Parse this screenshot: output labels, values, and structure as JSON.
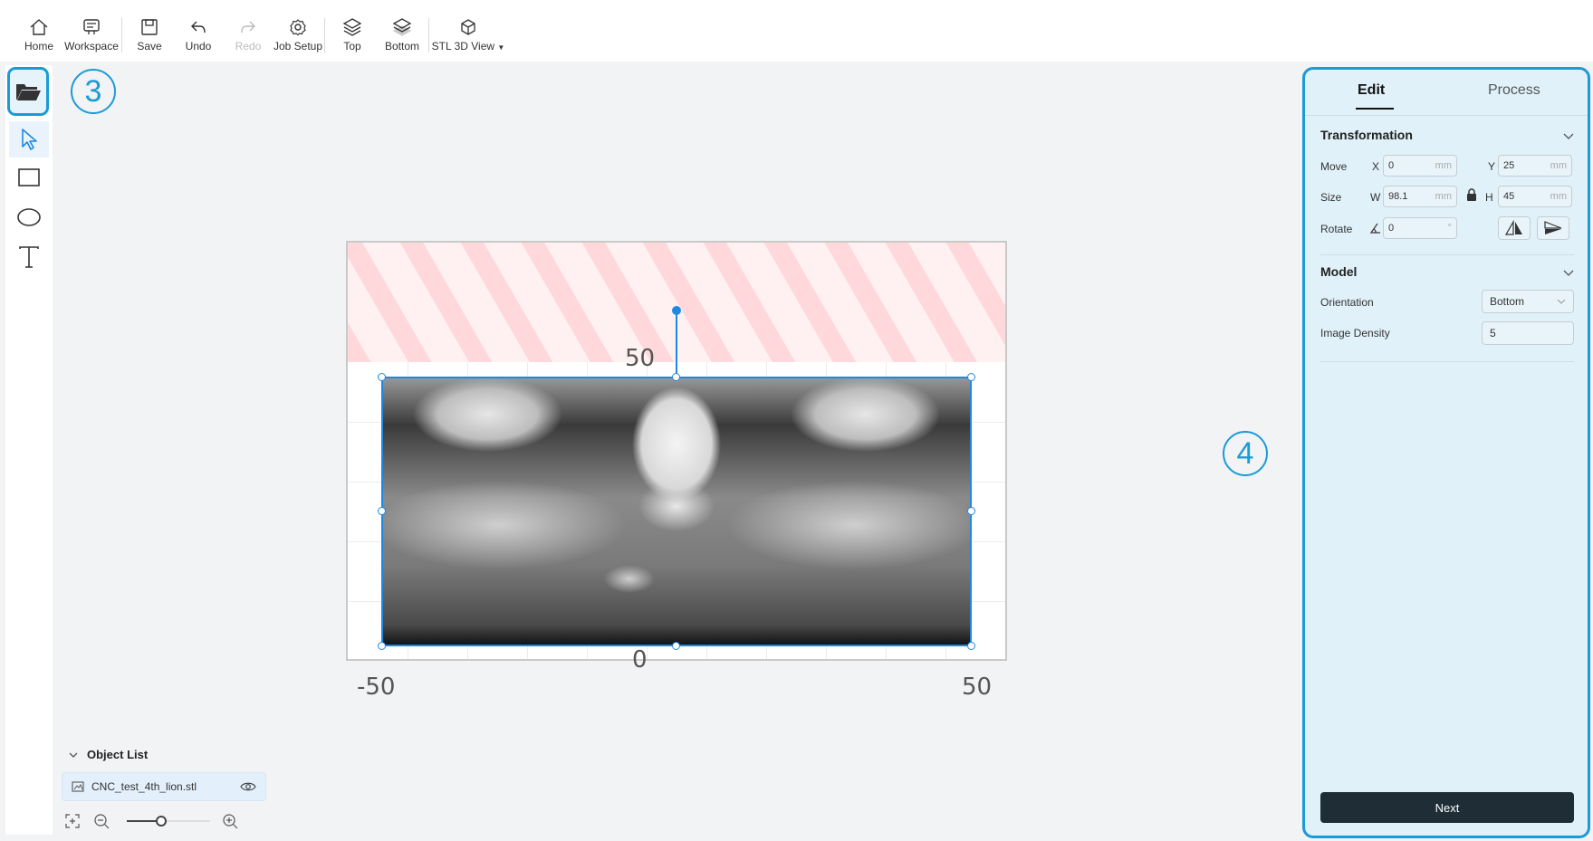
{
  "toolbar": {
    "home": "Home",
    "workspace": "Workspace",
    "save": "Save",
    "undo": "Undo",
    "redo": "Redo",
    "job_setup": "Job Setup",
    "top": "Top",
    "bottom": "Bottom",
    "stl_view": "STL 3D View"
  },
  "callouts": {
    "left": "3",
    "right": "4"
  },
  "axes": {
    "y_top": "50",
    "y_zero": "0",
    "x_left": "-50",
    "x_right": "50"
  },
  "object_list": {
    "title": "Object List",
    "items": [
      {
        "name": "CNC_test_4th_lion.stl"
      }
    ]
  },
  "panel": {
    "tabs": {
      "edit": "Edit",
      "process": "Process"
    },
    "transformation": {
      "title": "Transformation",
      "move_label": "Move",
      "size_label": "Size",
      "rotate_label": "Rotate",
      "x_label": "X",
      "y_label": "Y",
      "w_label": "W",
      "h_label": "H",
      "x_value": "0",
      "y_value": "25",
      "w_value": "98.1",
      "h_value": "45",
      "rotate_value": "0",
      "unit": "mm",
      "deg_unit": "°"
    },
    "model": {
      "title": "Model",
      "orientation_label": "Orientation",
      "orientation_value": "Bottom",
      "density_label": "Image Density",
      "density_value": "5"
    },
    "next": "Next"
  },
  "colors": {
    "accent": "#1a9bd7",
    "selection": "#1e88e5",
    "next_button": "#1f2d36"
  }
}
